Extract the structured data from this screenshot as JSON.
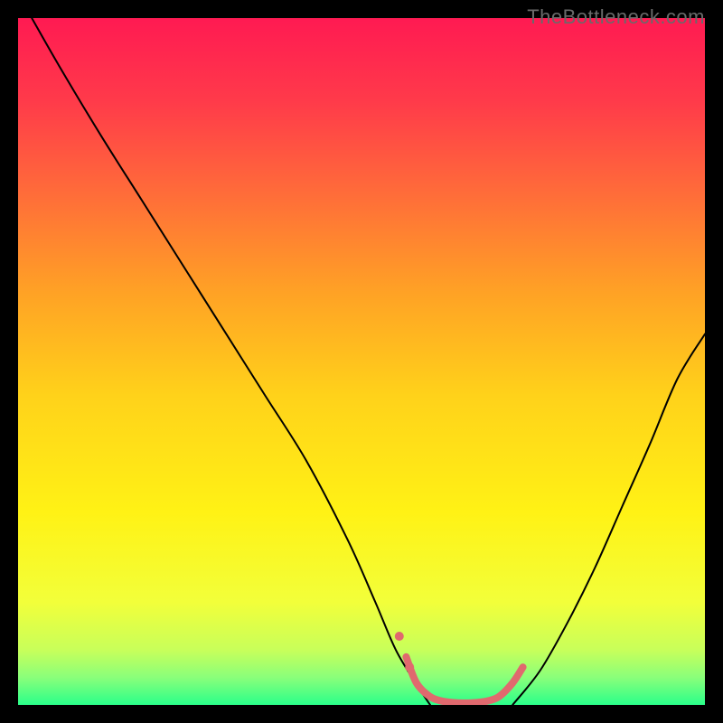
{
  "watermark": "TheBottleneck.com",
  "chart_data": {
    "type": "line",
    "title": "",
    "xlabel": "",
    "ylabel": "",
    "xlim": [
      0,
      100
    ],
    "ylim": [
      0,
      100
    ],
    "background_gradient": {
      "stops": [
        {
          "pos": 0.0,
          "color": "#ff1a52"
        },
        {
          "pos": 0.12,
          "color": "#ff3a4a"
        },
        {
          "pos": 0.25,
          "color": "#ff6a3a"
        },
        {
          "pos": 0.4,
          "color": "#ffa225"
        },
        {
          "pos": 0.55,
          "color": "#ffd21a"
        },
        {
          "pos": 0.72,
          "color": "#fff215"
        },
        {
          "pos": 0.85,
          "color": "#f2ff3a"
        },
        {
          "pos": 0.92,
          "color": "#c8ff5a"
        },
        {
          "pos": 0.96,
          "color": "#8aff7a"
        },
        {
          "pos": 1.0,
          "color": "#2aff8a"
        }
      ]
    },
    "series": [
      {
        "name": "left-curve",
        "color": "#000000",
        "width": 2,
        "x": [
          2,
          6,
          12,
          18,
          24,
          30,
          36,
          42,
          48,
          52,
          55,
          58,
          60
        ],
        "y": [
          100,
          93,
          83,
          73.5,
          64,
          54.5,
          45,
          35.5,
          24,
          15,
          8,
          3,
          0
        ]
      },
      {
        "name": "right-curve",
        "color": "#000000",
        "width": 2,
        "x": [
          72,
          76,
          80,
          84,
          88,
          92,
          96,
          100
        ],
        "y": [
          0,
          5,
          12,
          20,
          29,
          38,
          47.5,
          54
        ]
      },
      {
        "name": "valley-segment",
        "color": "#e0696e",
        "width": 8,
        "x": [
          56.5,
          58,
          60,
          62,
          64,
          66,
          68,
          70,
          72,
          73.5
        ],
        "y": [
          7,
          3.2,
          1.2,
          0.5,
          0.3,
          0.3,
          0.5,
          1.2,
          3.2,
          5.5
        ]
      },
      {
        "name": "valley-dot-upper",
        "type": "marker",
        "color": "#e0696e",
        "x": 55.5,
        "y": 10,
        "r": 5
      },
      {
        "name": "valley-dot-lower",
        "type": "marker",
        "color": "#e0696e",
        "x": 57,
        "y": 5.5,
        "r": 5
      }
    ]
  }
}
